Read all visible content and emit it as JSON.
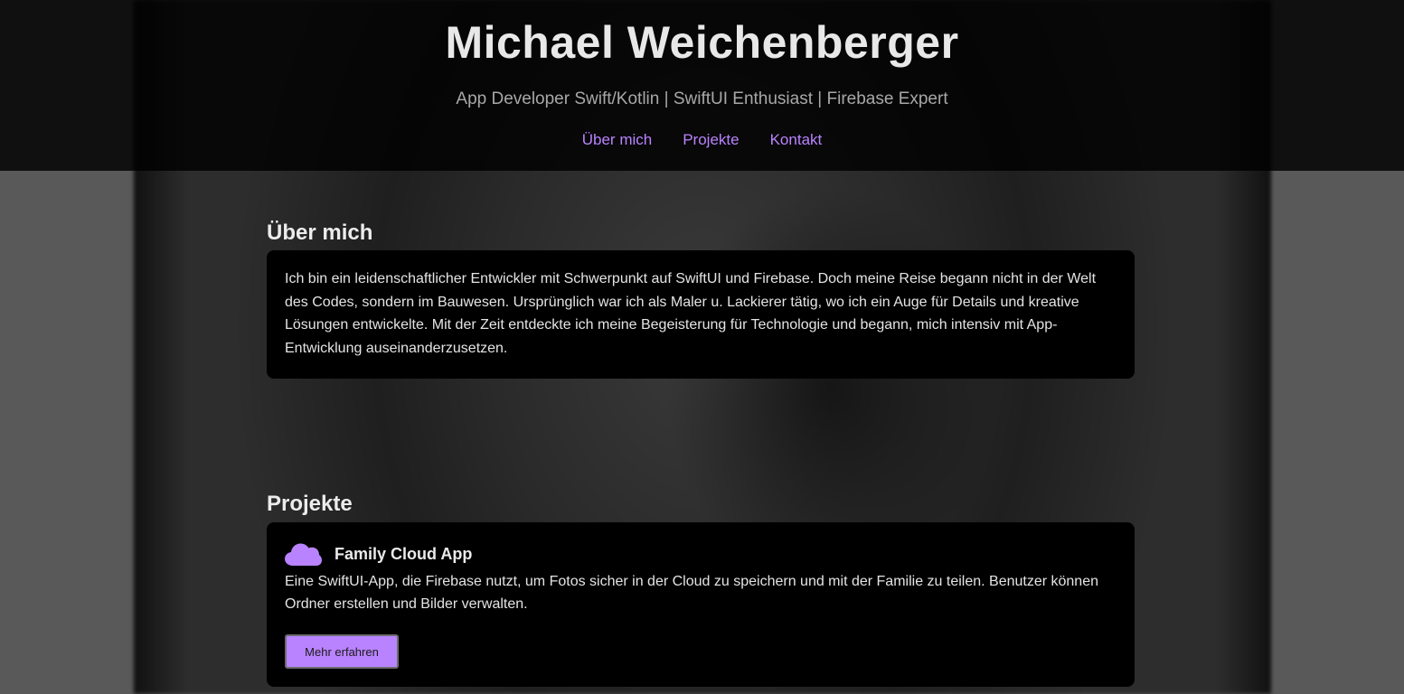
{
  "header": {
    "title": "Michael Weichenberger",
    "subtitle": "App Developer Swift/Kotlin | SwiftUI Enthusiast | Firebase Expert",
    "nav": [
      {
        "label": "Über mich"
      },
      {
        "label": "Projekte"
      },
      {
        "label": "Kontakt"
      }
    ]
  },
  "about": {
    "heading": "Über mich",
    "text": "Ich bin ein leidenschaftlicher Entwickler mit Schwerpunkt auf SwiftUI und Firebase. Doch meine Reise begann nicht in der Welt des Codes, sondern im Bauwesen. Ursprünglich war ich als Maler u. Lackierer tätig, wo ich ein Auge für Details und kreative Lösungen entwickelte. Mit der Zeit entdeckte ich meine Begeisterung für Technologie und begann, mich intensiv mit App-Entwicklung auseinanderzusetzen."
  },
  "projects": {
    "heading": "Projekte",
    "items": [
      {
        "icon": "cloud-icon",
        "title": "Family Cloud App",
        "description": "Eine SwiftUI-App, die Firebase nutzt, um Fotos sicher in der Cloud zu speichern und mit der Familie zu teilen. Benutzer können Ordner erstellen und Bilder verwalten.",
        "button_label": "Mehr erfahren"
      }
    ]
  },
  "colors": {
    "accent": "#b983ff",
    "header_bg": "#000000",
    "card_bg": "#000000",
    "page_bg": "#595959"
  }
}
